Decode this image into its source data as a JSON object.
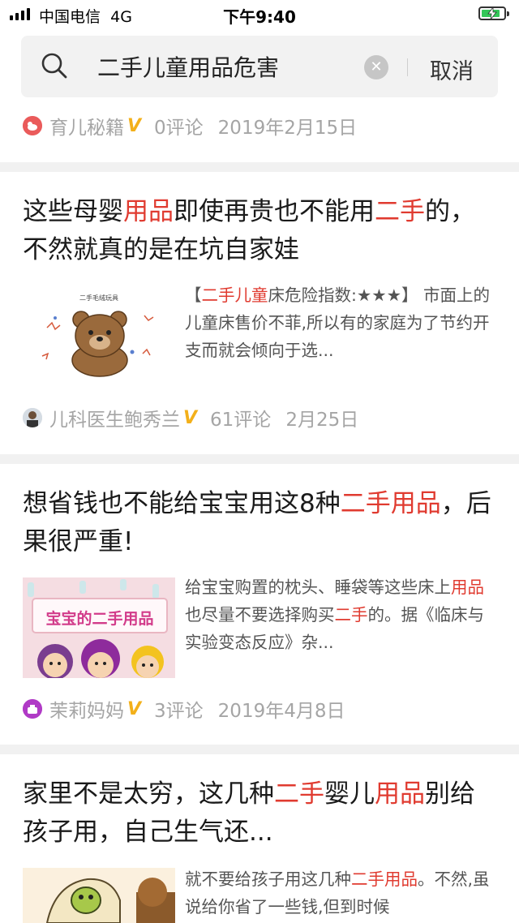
{
  "status_bar": {
    "carrier": "中国电信",
    "network": "4G",
    "time": "下午9:40"
  },
  "search": {
    "query": "二手儿童用品危害",
    "cancel_label": "取消",
    "icon": "search-icon",
    "clear_icon": "clear-icon"
  },
  "results": [
    {
      "author": "育儿秘籍",
      "verified": "V",
      "comments": "0评论",
      "date": "2019年2月15日"
    },
    {
      "title_parts": [
        "这些母婴",
        "用品",
        "即使再贵也不能用",
        "二手",
        "的，不然就真的是在坑自家娃"
      ],
      "snippet_parts": [
        "【",
        "二手儿童",
        "床危险指数:★★★】 市面上的儿童床售价不菲,所以有的家庭为了节约开支而就会倾向于选..."
      ],
      "thumb_caption": "二手毛绒玩具",
      "author": "儿科医生鲍秀兰",
      "verified": "V",
      "comments": "61评论",
      "date": "2月25日"
    },
    {
      "title_parts": [
        "想省钱也不能给宝宝用这8种",
        "二手用品",
        "，后果很严重!"
      ],
      "snippet_parts": [
        "给宝宝购置的枕头、睡袋等这些床上",
        "用品",
        "也尽量不要选择购买",
        "二手",
        "的。据《临床与实验变态反应》杂..."
      ],
      "thumb_caption": "宝宝的二手用品",
      "author": "茉莉妈妈",
      "verified": "V",
      "comments": "3评论",
      "date": "2019年4月8日"
    },
    {
      "title_parts": [
        "家里不是太穷，这几种",
        "二手",
        "婴儿",
        "用品",
        "别给孩子用，自己生气还..."
      ],
      "snippet_parts": [
        "就不要给孩子用这几种",
        "二手用品",
        "。不然,虽说给你省了一些钱,但到时候"
      ]
    }
  ],
  "colors": {
    "highlight": "#e03b30",
    "meta_text": "#a5a5a5",
    "verified_badge": "#f3b01a",
    "separator": "#f1f1f1"
  }
}
